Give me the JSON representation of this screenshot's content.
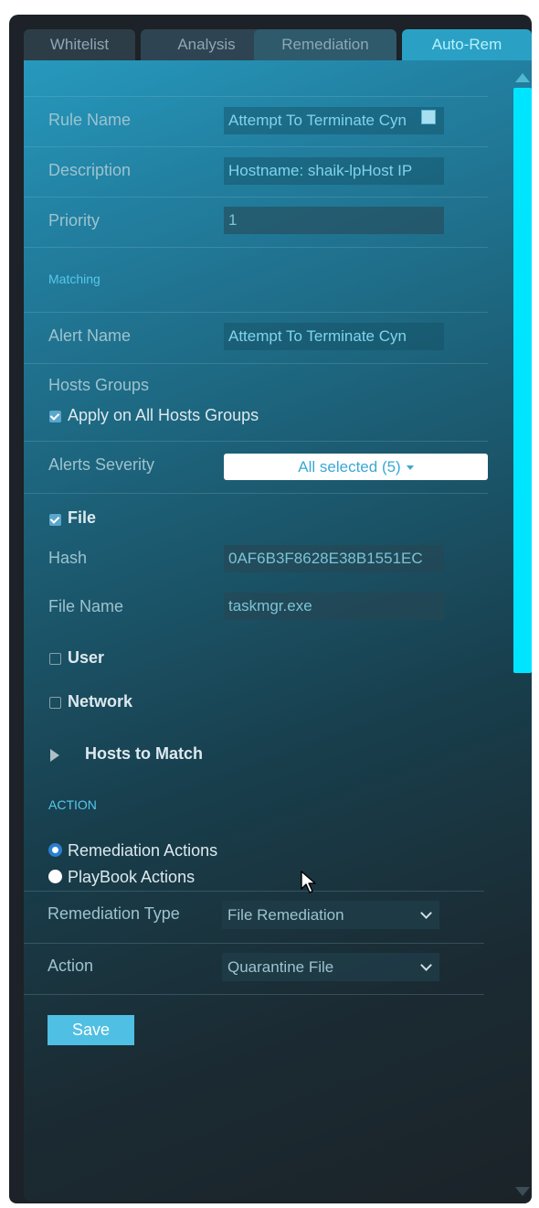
{
  "tabs": [
    {
      "label": "Whitelist",
      "active": false
    },
    {
      "label": "Analysis",
      "active": false
    },
    {
      "label": "Remediation",
      "active": false
    },
    {
      "label": "Auto-Rem",
      "active": true
    }
  ],
  "rule": {
    "name_label": "Rule Name",
    "name_value": "Attempt To Terminate Cyn",
    "description_label": "Description",
    "description_value": "Hostname: shaik-lpHost IP",
    "priority_label": "Priority",
    "priority_value": "1"
  },
  "matching": {
    "section_title": "Matching",
    "alert_name_label": "Alert Name",
    "alert_name_value": "Attempt To Terminate Cyn",
    "hosts_groups_label": "Hosts Groups",
    "apply_all_label": "Apply on All Hosts Groups",
    "apply_all_checked": true,
    "alerts_severity_label": "Alerts Severity",
    "alerts_severity_value": "All selected (5)",
    "file_label": "File",
    "file_checked": true,
    "hash_label": "Hash",
    "hash_value": "0AF6B3F8628E38B1551EC",
    "file_name_label": "File Name",
    "file_name_value": "taskmgr.exe",
    "user_label": "User",
    "user_checked": false,
    "network_label": "Network",
    "network_checked": false,
    "hosts_to_match_label": "Hosts to Match"
  },
  "action": {
    "section_title": "ACTION",
    "remediation_actions_label": "Remediation Actions",
    "playbook_actions_label": "PlayBook Actions",
    "selected_option": "Remediation Actions",
    "remediation_type_label": "Remediation Type",
    "remediation_type_value": "File Remediation",
    "action_label": "Action",
    "action_value": "Quarantine File"
  },
  "save_label": "Save",
  "colors": {
    "accent": "#4fbfe3",
    "active_tab": "#2aa0c4",
    "scrollbar": "#00e5ff",
    "section_title": "#56c8ec"
  },
  "icons": [
    "checkbox-checked-icon",
    "checkbox-unchecked-icon",
    "radio-selected-icon",
    "radio-unselected-icon",
    "caret-down-icon",
    "chevron-down-icon",
    "triangle-right-icon",
    "mouse-cursor-icon"
  ]
}
